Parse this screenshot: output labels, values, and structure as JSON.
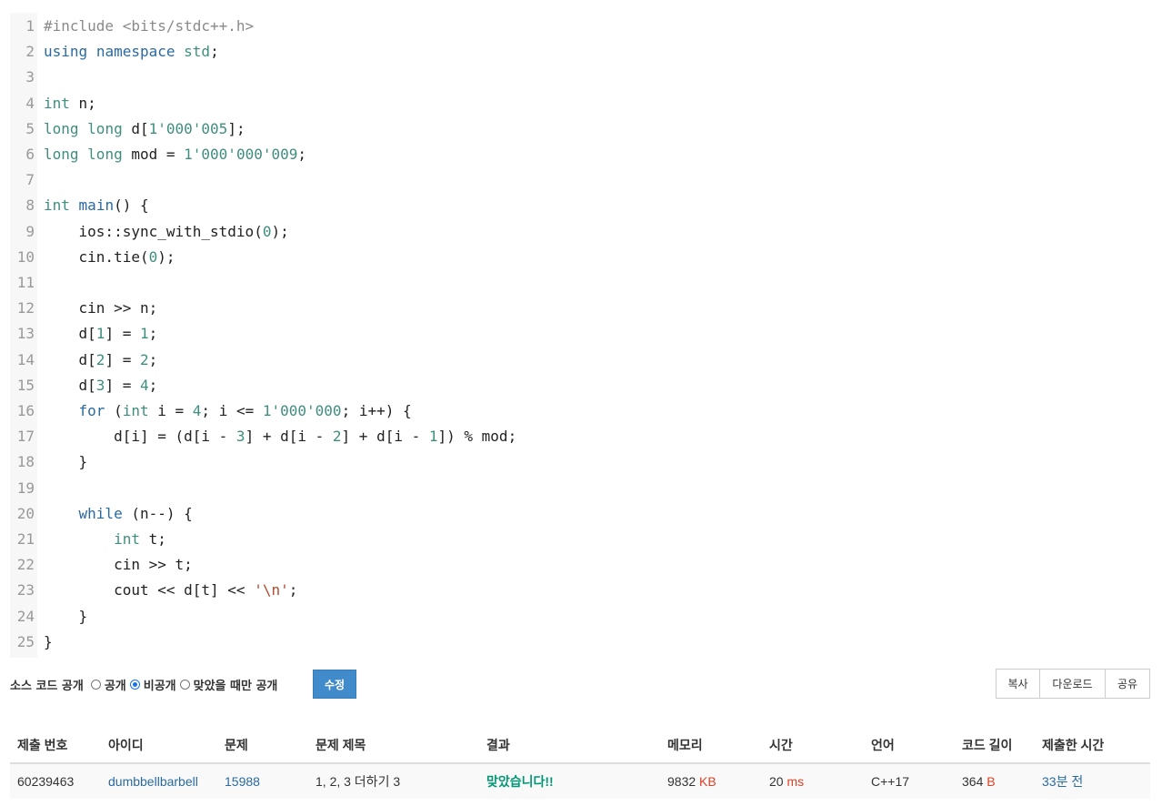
{
  "code": {
    "lines": [
      {
        "no": "1",
        "html": "<span class=\"p\">#include &lt;bits/stdc++.h&gt;</span>"
      },
      {
        "no": "2",
        "html": "<span class=\"k\">using</span> <span class=\"k\">namespace</span> <span class=\"t\">std</span>;"
      },
      {
        "no": "3",
        "html": ""
      },
      {
        "no": "4",
        "html": "<span class=\"t\">int</span> n;"
      },
      {
        "no": "5",
        "html": "<span class=\"t\">long</span> <span class=\"t\">long</span> d[<span class=\"n\">1'000'005</span>];"
      },
      {
        "no": "6",
        "html": "<span class=\"t\">long</span> <span class=\"t\">long</span> mod = <span class=\"n\">1'000'000'009</span>;"
      },
      {
        "no": "7",
        "html": ""
      },
      {
        "no": "8",
        "html": "<span class=\"t\">int</span> <span class=\"k\">main</span>() {"
      },
      {
        "no": "9",
        "html": "    ios::sync_with_stdio(<span class=\"n\">0</span>);"
      },
      {
        "no": "10",
        "html": "    cin.tie(<span class=\"n\">0</span>);"
      },
      {
        "no": "11",
        "html": ""
      },
      {
        "no": "12",
        "html": "    cin &gt;&gt; n;"
      },
      {
        "no": "13",
        "html": "    d[<span class=\"n\">1</span>] = <span class=\"n\">1</span>;"
      },
      {
        "no": "14",
        "html": "    d[<span class=\"n\">2</span>] = <span class=\"n\">2</span>;"
      },
      {
        "no": "15",
        "html": "    d[<span class=\"n\">3</span>] = <span class=\"n\">4</span>;"
      },
      {
        "no": "16",
        "html": "    <span class=\"k\">for</span> (<span class=\"t\">int</span> i = <span class=\"n\">4</span>; i &lt;= <span class=\"n\">1'000'000</span>; i++) {"
      },
      {
        "no": "17",
        "html": "        d[i] = (d[i - <span class=\"n\">3</span>] + d[i - <span class=\"n\">2</span>] + d[i - <span class=\"n\">1</span>]) % mod;"
      },
      {
        "no": "18",
        "html": "    }"
      },
      {
        "no": "19",
        "html": ""
      },
      {
        "no": "20",
        "html": "    <span class=\"k\">while</span> (n--) {"
      },
      {
        "no": "21",
        "html": "        <span class=\"t\">int</span> t;"
      },
      {
        "no": "22",
        "html": "        cin &gt;&gt; t;"
      },
      {
        "no": "23",
        "html": "        cout &lt;&lt; d[t] &lt;&lt; <span class=\"s\">'\\n'</span>;"
      },
      {
        "no": "24",
        "html": "    }"
      },
      {
        "no": "25",
        "html": "}"
      }
    ]
  },
  "source_options": {
    "label": "소스 코드 공개",
    "public": "공개",
    "private": "비공개",
    "accepted_only": "맞았을 때만 공개",
    "selected": "private",
    "edit_button": "수정"
  },
  "actions": {
    "copy": "복사",
    "download": "다운로드",
    "share": "공유"
  },
  "table": {
    "headers": [
      "제출 번호",
      "아이디",
      "문제",
      "문제 제목",
      "결과",
      "메모리",
      "시간",
      "언어",
      "코드 길이",
      "제출한 시간"
    ],
    "row": {
      "submission_id": "60239463",
      "user": "dumbbellbarbell",
      "problem": "15988",
      "title": "1, 2, 3 더하기 3",
      "result": "맞았습니다!!",
      "memory": "9832",
      "memory_unit": "KB",
      "time": "20",
      "time_unit": "ms",
      "language": "C++17",
      "code_length": "364",
      "code_length_unit": "B",
      "submitted": "33분 전"
    }
  },
  "colors": {
    "accent": "#428bca",
    "link": "#2a6aa0",
    "success": "#009874",
    "unit": "#dd4124"
  }
}
